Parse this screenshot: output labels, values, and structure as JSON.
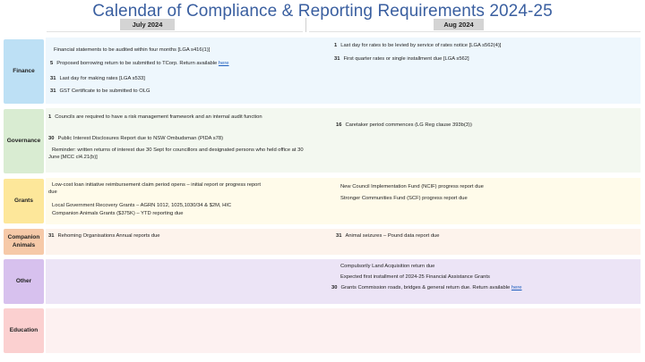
{
  "title": "Calendar of Compliance & Reporting Requirements 2024-25",
  "months": {
    "left": "July 2024",
    "right": "Aug 2024"
  },
  "colors": {
    "finance_label": "#bde0f5",
    "finance_row": "#eef7fd",
    "governance_label": "#d9ecd2",
    "governance_row": "#f3f8f0",
    "grants_label": "#fde79a",
    "grants_row": "#fffbea",
    "companion_label": "#f6c9a8",
    "companion_row": "#fdf3ec",
    "other_label": "#d7c1ee",
    "other_row": "#ece4f6",
    "education_label": "#fbd0d0",
    "education_row": "#fdf1f1"
  },
  "rows": {
    "finance": {
      "label": "Finance",
      "left": [
        {
          "day": "",
          "text": "Financial statements to be audited within four months [LGA s416(1)]"
        },
        {
          "day": "5",
          "text": "Proposed borrowing return to be submitted to TCorp.  Return available ",
          "link": "here"
        },
        {
          "day": "31",
          "text": "Last day for making rates  [LGA s533]"
        },
        {
          "day": "31",
          "text": "GST Certificate to be submitted to OLG"
        }
      ],
      "right": [
        {
          "day": "1",
          "text": "Last day for rates to be levied by service of rates notice [LGA s562(4)]"
        },
        {
          "day": "31",
          "text": "First quarter rates or single installment due  [LGA s562]"
        }
      ]
    },
    "governance": {
      "label": "Governance",
      "left": [
        {
          "day": "1",
          "text": "Councils are required to have a risk management framework and an internal audit function"
        },
        {
          "day": "30",
          "text": "Public Interest Disclosures Report due to NSW Ombudsman (PIDA s78)"
        },
        {
          "day": "",
          "text": "Reminder: written returns of interest due 30 Sept for councillors and designated persons who held office at 30 June [MCC cl4.21(b)]"
        }
      ],
      "right": [
        {
          "day": "16",
          "text": "Caretaker period commences (LG Reg clause 393b(3))"
        }
      ]
    },
    "grants": {
      "label": "Grants",
      "left": [
        {
          "day": "",
          "text": "Low-cost loan initiative reimbursement claim period opens – initial report or progress report due"
        },
        {
          "day": "",
          "text": "Local Government Recovery Grants – AGRN 1012, 1025,1030/34 & $2M, HIC"
        },
        {
          "day": "",
          "text": "Companion Animals Grants ($375K) – YTD reporting due"
        }
      ],
      "right": [
        {
          "day": "",
          "text": "New Council Implementation Fund (NCIF)  progress report due"
        },
        {
          "day": "",
          "text": "Stronger Communities Fund (SCF) progress report due"
        }
      ]
    },
    "companion": {
      "label": "Companion Animals",
      "left": [
        {
          "day": "31",
          "text": "Rehoming Organisations Annual reports due"
        }
      ],
      "right": [
        {
          "day": "31",
          "text": "Animal seizures – Pound data report due"
        }
      ]
    },
    "other": {
      "label": "Other",
      "left": [],
      "right": [
        {
          "day": "",
          "text": "Compulsorily Land Acquisition return due"
        },
        {
          "day": "",
          "text": "Expected first installment of 2024-25 Financial Assistance Grants"
        },
        {
          "day": "30",
          "text": "Grants Commission roads, bridges & general return due. Return available ",
          "link": "here"
        }
      ]
    },
    "education": {
      "label": "Education",
      "left": [],
      "right": []
    }
  }
}
